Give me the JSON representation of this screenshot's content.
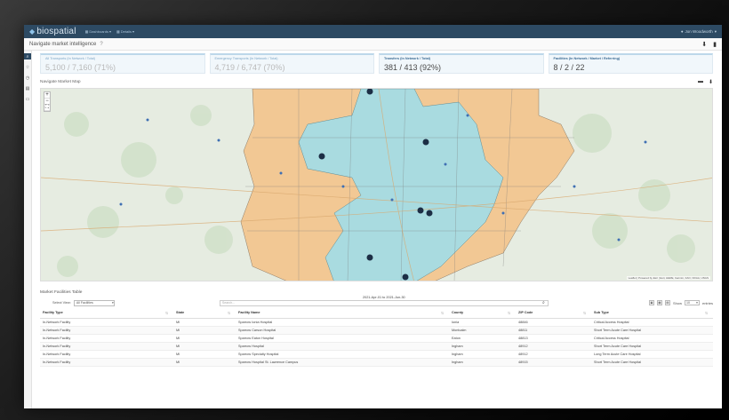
{
  "app": {
    "brand": "biospatial",
    "nav": [
      {
        "label": "Dashboards"
      },
      {
        "label": "Details"
      }
    ],
    "user": "Jon Woodworth"
  },
  "page": {
    "title": "Navigate market intelligence"
  },
  "kpis": [
    {
      "label": "All Transports (In Network / Total)",
      "value": "5,100 / 7,160 (71%)"
    },
    {
      "label": "Emergency Transports (In Network / Total)",
      "value": "4,719 / 6,747 (70%)"
    },
    {
      "label": "Transfers (In Network / Total)",
      "value": "381 / 413 (92%)"
    },
    {
      "label": "Facilities (In Network / Market / Referring)",
      "value": "8 / 2 / 22"
    }
  ],
  "map": {
    "title": "Navigate Market Map",
    "attribution": "Leaflet | Powered by Esri | Esri, HERE, Garmin, FAO, NOAA, USGS"
  },
  "table": {
    "title": "Market Facilities Table",
    "date_range": "2021-Apr-01 to 2021-Jun-30",
    "select_label": "Select View:",
    "select_value": "All Facilities",
    "search_placeholder": "Search...",
    "show_label": "Show",
    "show_value": "10",
    "entries_label": "entries",
    "columns": [
      "Facility Type",
      "State",
      "Facility Name",
      "County",
      "ZIP Code",
      "Sub Type"
    ],
    "rows": [
      [
        "In-Network Facility",
        "MI",
        "Sparrow Ionia Hospital",
        "Ionia",
        "48846",
        "Critical Access Hospital"
      ],
      [
        "In-Network Facility",
        "MI",
        "Sparrow Carson Hospital",
        "Montcalm",
        "48811",
        "Short Term Acute Care Hospital"
      ],
      [
        "In-Network Facility",
        "MI",
        "Sparrow Eaton Hospital",
        "Eaton",
        "48813",
        "Critical Access Hospital"
      ],
      [
        "In-Network Facility",
        "MI",
        "Sparrow Hospital",
        "Ingham",
        "48912",
        "Short Term Acute Care Hospital"
      ],
      [
        "In-Network Facility",
        "MI",
        "Sparrow Specialty Hospital",
        "Ingham",
        "48912",
        "Long Term Acute Care Hospital"
      ],
      [
        "In-Network Facility",
        "MI",
        "Sparrow Hospital St. Lawrence Campus",
        "Ingham",
        "48915",
        "Short Term Acute Care Hospital"
      ]
    ]
  },
  "colors": {
    "navbar": "#2d4a63",
    "in_network_region": "#a9dbe0",
    "market_region": "#f2c894",
    "base_map": "#e6ece1"
  }
}
